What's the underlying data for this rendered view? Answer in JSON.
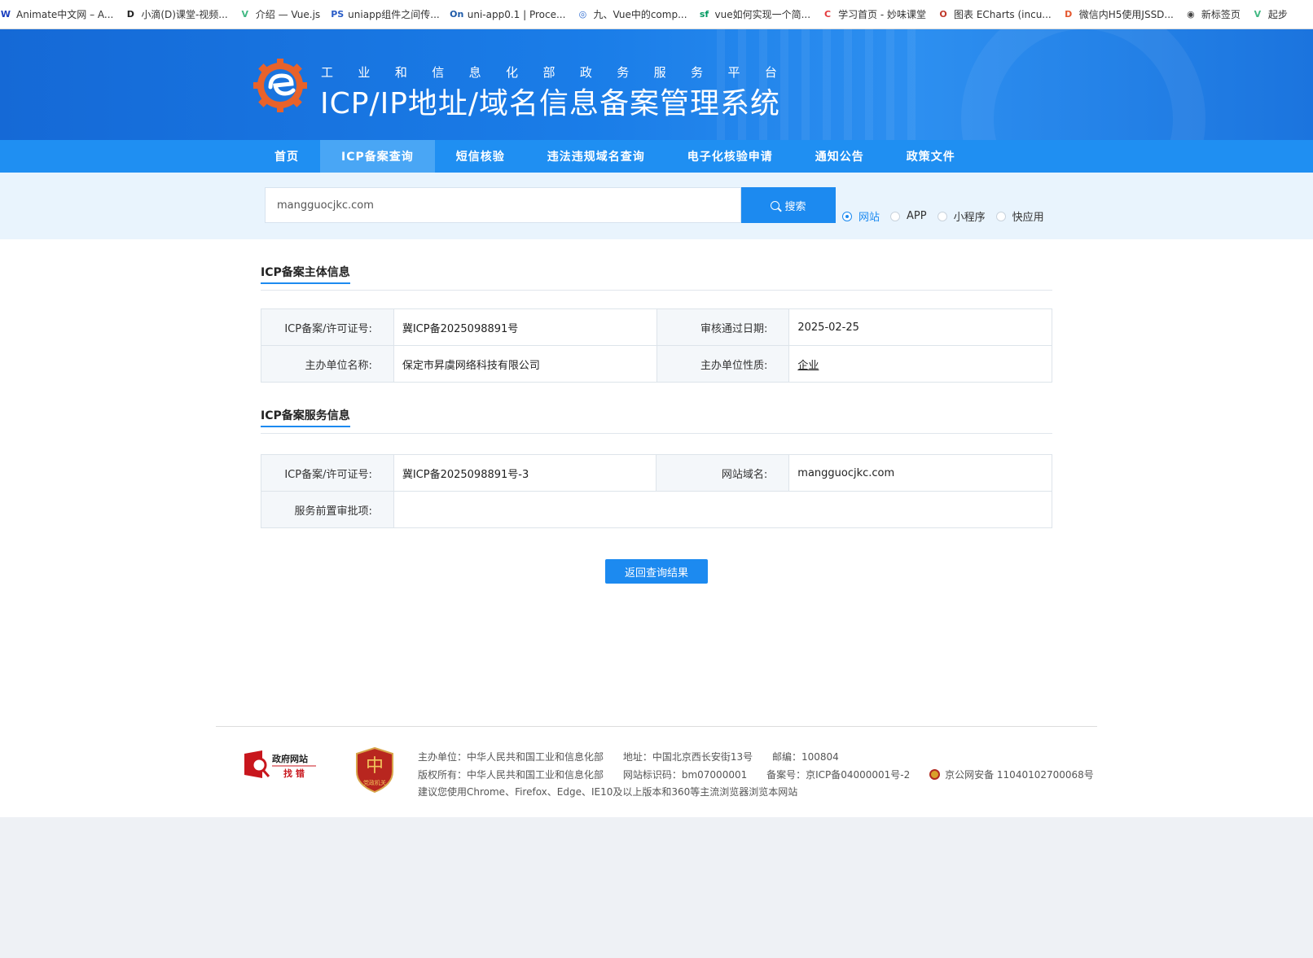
{
  "bookmarks": [
    {
      "icon": "W",
      "color": "#1a3fbf",
      "label": "Animate中文网 – A..."
    },
    {
      "icon": "D",
      "color": "#222222",
      "label": "小滴(D)课堂-视频..."
    },
    {
      "icon": "V",
      "color": "#41b883",
      "label": "介绍 — Vue.js"
    },
    {
      "icon": "PS",
      "color": "#2a5cc7",
      "label": "uniapp组件之间传..."
    },
    {
      "icon": "On",
      "color": "#1e5aa8",
      "label": "uni-app0.1 | Proce..."
    },
    {
      "icon": "◎",
      "color": "#2a6ad1",
      "label": "九、Vue中的comp..."
    },
    {
      "icon": "sf",
      "color": "#009a61",
      "label": "vue如何实现一个简..."
    },
    {
      "icon": "C",
      "color": "#e4393c",
      "label": "学习首页 - 妙味课堂"
    },
    {
      "icon": "O",
      "color": "#c0392b",
      "label": "图表 ECharts (incu..."
    },
    {
      "icon": "D",
      "color": "#e4572e",
      "label": "微信内H5使用JSSD..."
    },
    {
      "icon": "◉",
      "color": "#444444",
      "label": "新标签页"
    },
    {
      "icon": "V",
      "color": "#41b883",
      "label": "起步"
    }
  ],
  "header": {
    "subtitle_chars": [
      "工",
      "业",
      "和",
      "信",
      "息",
      "化",
      "部",
      "政",
      "务",
      "服",
      "务",
      "平",
      "台"
    ],
    "title": "ICP/IP地址/域名信息备案管理系统"
  },
  "nav": {
    "items": [
      "首页",
      "ICP备案查询",
      "短信核验",
      "违法违规域名查询",
      "电子化核验申请",
      "通知公告",
      "政策文件"
    ],
    "active_index": 1
  },
  "search": {
    "value": "mangguocjkc.com",
    "button_label": "搜索",
    "types": [
      "网站",
      "APP",
      "小程序",
      "快应用"
    ],
    "selected_type": "网站"
  },
  "subject_info": {
    "title": "ICP备案主体信息",
    "license_label": "ICP备案/许可证号:",
    "license_value": "冀ICP备2025098891号",
    "approve_date_label": "审核通过日期:",
    "approve_date_value": "2025-02-25",
    "org_name_label": "主办单位名称:",
    "org_name_value": "保定市昇虞网络科技有限公司",
    "org_type_label": "主办单位性质:",
    "org_type_value": "企业"
  },
  "service_info": {
    "title": "ICP备案服务信息",
    "license_label": "ICP备案/许可证号:",
    "license_value": "冀ICP备2025098891号-3",
    "domain_label": "网站域名:",
    "domain_value": "mangguocjkc.com",
    "preapproval_label": "服务前置审批项:",
    "preapproval_value": ""
  },
  "back_button": "返回查询结果",
  "footer": {
    "gov_logo_text1": "政府网站",
    "gov_logo_text2": "找 错",
    "party_logo_text": "党政机关",
    "host": "主办单位：中华人民共和国工业和信息化部",
    "address": "地址：中国北京西长安街13号",
    "postcode": "邮编：100804",
    "copyright": "版权所有：中华人民共和国工业和信息化部",
    "site_id": "网站标识码：bm07000001",
    "icp": "备案号：京ICP备04000001号-2",
    "police": "京公网安备 11040102700068号",
    "browser_tip": "建议您使用Chrome、Firefox、Edge、IE10及以上版本和360等主流浏览器浏览本网站"
  },
  "colors": {
    "accent": "#1c8af0",
    "nav_bg": "#1f8ff2",
    "nav_active": "#49a6f5"
  }
}
